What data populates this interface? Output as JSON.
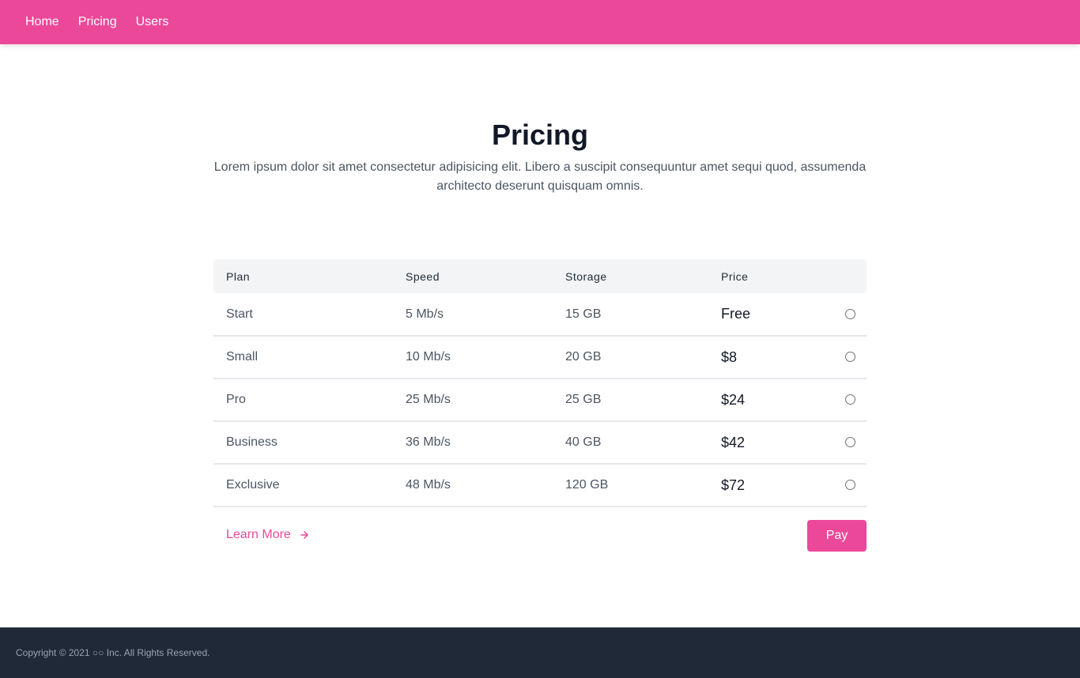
{
  "nav": {
    "items": [
      {
        "label": "Home"
      },
      {
        "label": "Pricing"
      },
      {
        "label": "Users"
      }
    ]
  },
  "header": {
    "title": "Pricing",
    "subtitle": "Lorem ipsum dolor sit amet consectetur adipisicing elit. Libero a suscipit consequuntur amet sequi quod, assumenda architecto deserunt quisquam omnis."
  },
  "table": {
    "columns": [
      "Plan",
      "Speed",
      "Storage",
      "Price"
    ],
    "rows": [
      {
        "plan": "Start",
        "speed": "5 Mb/s",
        "storage": "15 GB",
        "price": "Free"
      },
      {
        "plan": "Small",
        "speed": "10 Mb/s",
        "storage": "20 GB",
        "price": "$8"
      },
      {
        "plan": "Pro",
        "speed": "25 Mb/s",
        "storage": "25 GB",
        "price": "$24"
      },
      {
        "plan": "Business",
        "speed": "36 Mb/s",
        "storage": "40 GB",
        "price": "$42"
      },
      {
        "plan": "Exclusive",
        "speed": "48 Mb/s",
        "storage": "120 GB",
        "price": "$72"
      }
    ]
  },
  "actions": {
    "learn_more_label": "Learn More",
    "pay_label": "Pay"
  },
  "footer": {
    "text": "Copyright © 2021 ○○ Inc. All Rights Reserved."
  },
  "colors": {
    "accent": "#ec4899",
    "footer_bg": "#1f2937"
  },
  "icons": {
    "learn_more": "arrow-right-icon"
  }
}
